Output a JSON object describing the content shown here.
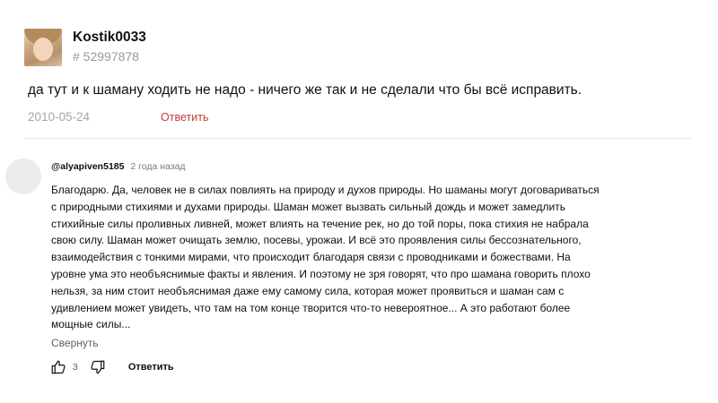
{
  "top_comment": {
    "username": "Kostik0033",
    "user_id": "# 52997878",
    "text": "да тут и к шаману ходить не надо - ничего же так и не сделали что бы всё исправить.",
    "date": "2010-05-24",
    "reply_label": "Ответить"
  },
  "yt_comment": {
    "author": "@alyapiven5185",
    "time": "2 года назад",
    "lines": [
      "Благодарю. Да, человек не в силах повлиять на природу и духов природы. Но шаманы могут договариваться",
      "с природными стихиями и духами природы. Шаман может вызвать сильный дождь и может замедлить",
      "стихийные силы проливных ливней, может влиять на течение рек, но до той поры, пока стихия не набрала",
      "свою силу. Шаман может очищать землю, посевы, урожаи. И всё это проявления силы бессознательного,",
      "взаимодействия с тонкими мирами, что происходит благодаря связи с проводниками и божествами. На",
      "уровне ума это необъяснимые факты и явления. И поэтому не зря говорят, что про шамана говорить плохо",
      "нельзя, за ним стоит необъяснимая даже ему самому сила, которая может проявиться и шаман сам с",
      "удивлением может увидеть, что там на том конце творится что-то невероятное... А это работают более",
      "мощные силы..."
    ],
    "collapse_label": "Свернуть",
    "like_count": "3",
    "reply_label": "Ответить"
  }
}
